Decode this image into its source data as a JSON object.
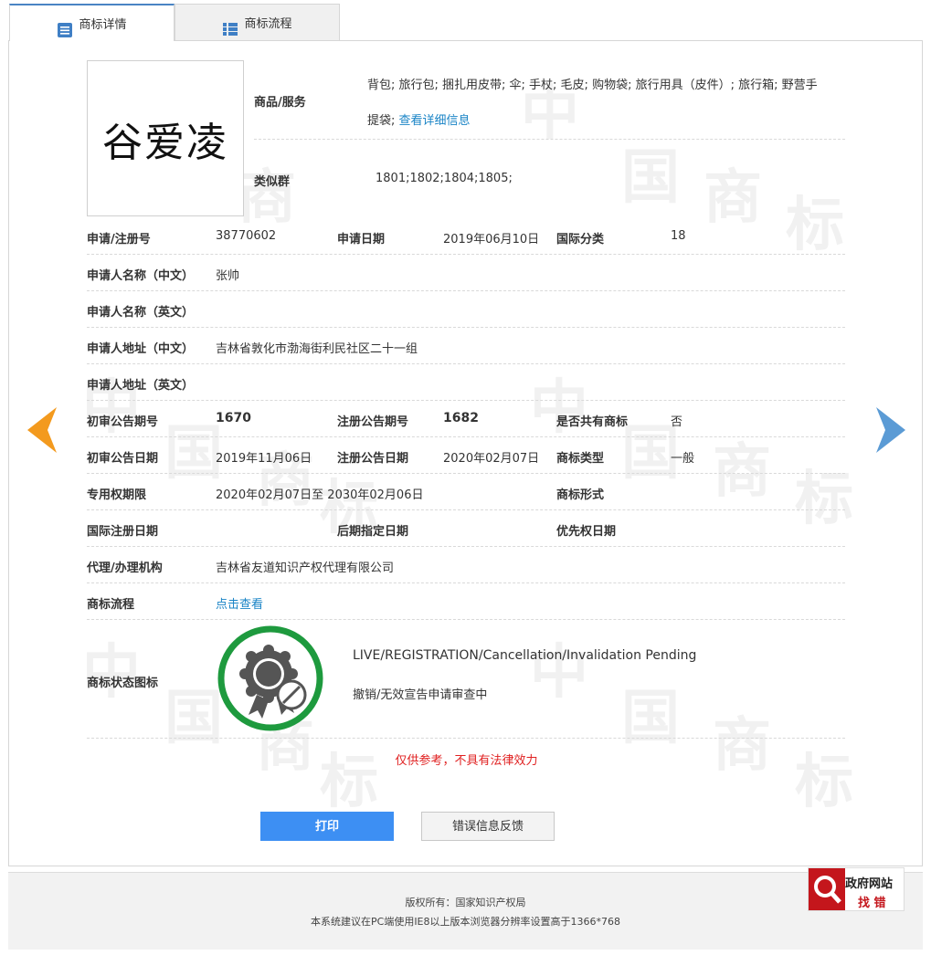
{
  "tabs": [
    {
      "label": "商标详情",
      "active": true,
      "icon": "document-list-icon"
    },
    {
      "label": "商标流程",
      "active": false,
      "icon": "grid-list-icon"
    }
  ],
  "mark": {
    "logo_text": "谷爱凌",
    "goods_label": "商品/服务",
    "goods_value": "背包; 旅行包; 捆扎用皮带; 伞; 手杖; 毛皮; 购物袋; 旅行用具（皮件）; 旅行箱; 野营手",
    "goods_value_2": "提袋;",
    "goods_link": "查看详细信息",
    "similar_label": "类似群",
    "similar_value": "1801;1802;1804;1805;"
  },
  "details": {
    "reg_no_label": "申请/注册号",
    "reg_no": "38770602",
    "apply_date_label": "申请日期",
    "apply_date": "2019年06月10日",
    "intl_class_label": "国际分类",
    "intl_class": "18",
    "applicant_cn_label": "申请人名称（中文）",
    "applicant_cn": "张帅",
    "applicant_en_label": "申请人名称（英文）",
    "applicant_en": "",
    "address_cn_label": "申请人地址（中文）",
    "address_cn": "吉林省敦化市渤海街利民社区二十一组",
    "address_en_label": "申请人地址（英文）",
    "address_en": "",
    "prelim_issue_label": "初审公告期号",
    "prelim_issue": "1670",
    "reg_issue_label": "注册公告期号",
    "reg_issue": "1682",
    "shared_label": "是否共有商标",
    "shared": "否",
    "prelim_date_label": "初审公告日期",
    "prelim_date": "2019年11月06日",
    "reg_date_label": "注册公告日期",
    "reg_date": "2020年02月07日",
    "mark_type_label": "商标类型",
    "mark_type": "一般",
    "exclusive_label": "专用权期限",
    "exclusive": "2020年02月07日至 2030年02月06日",
    "mark_form_label": "商标形式",
    "mark_form": "",
    "intl_reg_date_label": "国际注册日期",
    "intl_reg_date": "",
    "later_designation_label": "后期指定日期",
    "later_designation": "",
    "priority_date_label": "优先权日期",
    "priority_date": "",
    "agent_label": "代理/办理机构",
    "agent": "吉林省友道知识产权代理有限公司",
    "process_label": "商标流程",
    "process_link": "点击查看",
    "status_label": "商标状态图标",
    "status_en": "LIVE/REGISTRATION/Cancellation/Invalidation Pending",
    "status_cn": "撤销/无效宣告申请审查中"
  },
  "disclaimer": "仅供参考，不具有法律效力",
  "buttons": {
    "print": "打印",
    "feedback": "错误信息反馈"
  },
  "nav": {
    "prev_icon": "left-arrow-icon",
    "next_icon": "right-arrow-icon",
    "prev_color": "#f39a1e",
    "next_color": "#5b9bd5"
  },
  "watermark": {
    "chars": [
      "中",
      "国",
      "商",
      "标"
    ]
  },
  "footer": {
    "copyright": "版权所有：国家知识产权局",
    "browser_note": "本系统建议在PC端使用IE8以上版本浏览器分辨率设置高于1366*768"
  },
  "gov_badge": {
    "line1": "政府网站",
    "line2": "找 错",
    "color": "#c4161c"
  }
}
